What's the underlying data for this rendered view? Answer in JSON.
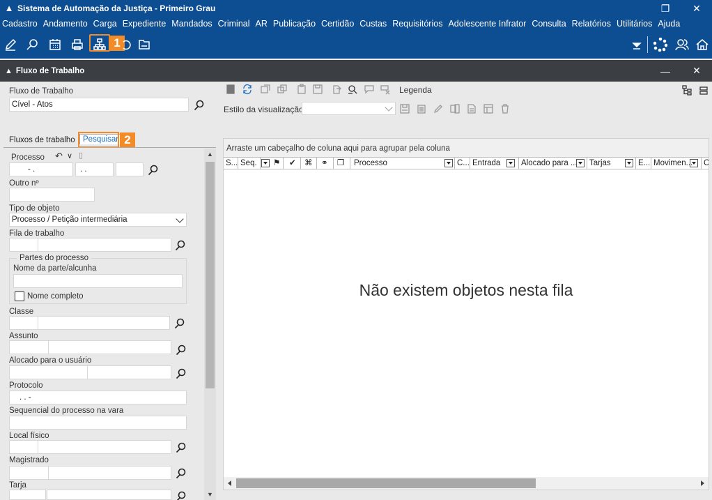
{
  "titlebar": {
    "title": "Sistema de Automação da Justiça - Primeiro Grau"
  },
  "menu": [
    "Cadastro",
    "Andamento",
    "Carga",
    "Expediente",
    "Mandados",
    "Criminal",
    "AR",
    "Publicação",
    "Certidão",
    "Custas",
    "Requisitórios",
    "Adolescente Infrator",
    "Consulta",
    "Relatórios",
    "Utilitários",
    "Ajuda"
  ],
  "steps": {
    "one": "1",
    "two": "2"
  },
  "window": {
    "title": "Fluxo de Trabalho"
  },
  "left": {
    "fluxo_label": "Fluxo de Trabalho",
    "fluxo_value": "Cível - Atos",
    "tabs": {
      "fluxos": "Fluxos de trabalho",
      "pesquisar": "Pesquisar"
    },
    "processo_label": "Processo",
    "processo_part1": "-  .",
    "processo_part2": ".  .",
    "outro_label": "Outro nº",
    "tipo_label": "Tipo de objeto",
    "tipo_value": "Processo / Petição intermediária",
    "fila_label": "Fila de trabalho",
    "partes_legend": "Partes do processo",
    "nome_parte_label": "Nome da parte/alcunha",
    "nome_completo_label": "Nome completo",
    "classe_label": "Classe",
    "assunto_label": "Assunto",
    "alocado_label": "Alocado para o usuário",
    "protocolo_label": "Protocolo",
    "protocolo_value": ".  .  -",
    "sequencial_label": "Sequencial do processo na vara",
    "local_label": "Local físico",
    "magistrado_label": "Magistrado",
    "tarja_label": "Tarja"
  },
  "right": {
    "legenda": "Legenda",
    "estilo_label": "Estilo da visualização",
    "group_hint": "Arraste um cabeçalho de coluna aqui para agrupar pela coluna",
    "columns": {
      "s": "S...",
      "seq": "Seq.",
      "processo": "Processo",
      "c": "C...",
      "entrada": "Entrada",
      "alocado": "Alocado para ...",
      "tarjas": "Tarjas",
      "e": "E...",
      "movimen": "Movimen...",
      "c2": "C"
    },
    "empty_message": "Não existem objetos nesta fila"
  }
}
